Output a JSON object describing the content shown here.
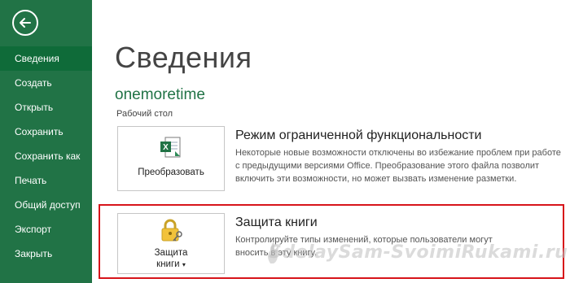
{
  "sidebar": {
    "items": [
      {
        "label": "Сведения",
        "active": true
      },
      {
        "label": "Создать"
      },
      {
        "label": "Открыть"
      },
      {
        "label": "Сохранить"
      },
      {
        "label": "Сохранить как"
      },
      {
        "label": "Печать"
      },
      {
        "label": "Общий доступ"
      },
      {
        "label": "Экспорт"
      },
      {
        "label": "Закрыть"
      }
    ],
    "color": "#217346"
  },
  "main": {
    "title": "Сведения",
    "document_name": "onemoretime",
    "document_location": "Рабочий стол"
  },
  "sections": {
    "compat": {
      "button_label": "Преобразовать",
      "icon": "excel-convert-icon",
      "title": "Режим ограниченной функциональности",
      "description": "Некоторые новые возможности отключены во избежание проблем при работе с предыдущими версиями Office. Преобразование этого файла позволит включить эти возможности, но может вызвать изменение разметки."
    },
    "protect": {
      "button_label_line1": "Защита",
      "button_label_line2": "книги",
      "dropdown_glyph": "▾",
      "icon": "lock-key-icon",
      "title": "Защита книги",
      "description": "Контролируйте типы изменений, которые пользователи могут вносить в эту книгу."
    }
  },
  "watermark": "SdelaySam-SvoimiRukami.ru"
}
